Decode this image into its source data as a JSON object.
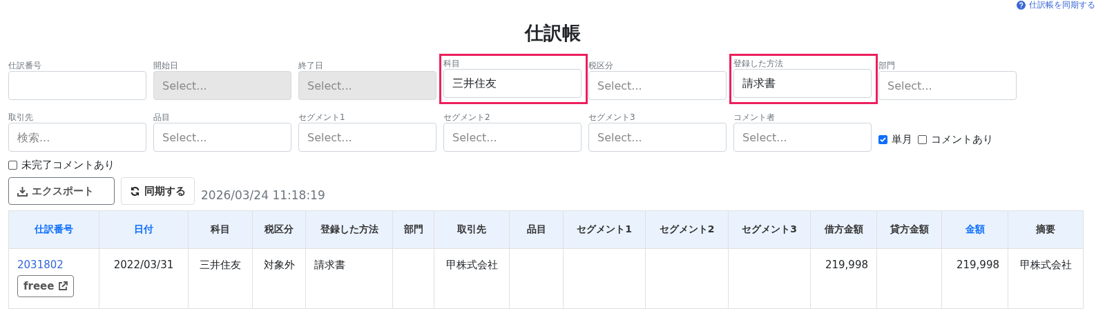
{
  "sync_link": {
    "label": "仕訳帳を同期する"
  },
  "title": "仕訳帳",
  "filters": [
    {
      "label": "仕訳番号",
      "disabled": false,
      "highlighted": false
    },
    {
      "label": "開始日",
      "placeholder": "Select...",
      "disabled": true,
      "highlighted": false
    },
    {
      "label": "終了日",
      "placeholder": "Select...",
      "disabled": true,
      "highlighted": false
    },
    {
      "label": "科目",
      "value": "三井住友",
      "disabled": false,
      "highlighted": true
    },
    {
      "label": "税区分",
      "placeholder": "Select...",
      "disabled": false,
      "highlighted": false
    },
    {
      "label": "登録した方法",
      "value": "請求書",
      "disabled": false,
      "highlighted": true
    },
    {
      "label": "部門",
      "placeholder": "Select...",
      "disabled": false,
      "highlighted": false
    },
    {
      "label": "取引先",
      "placeholder": "検索...",
      "disabled": false,
      "highlighted": false
    },
    {
      "label": "品目",
      "placeholder": "Select...",
      "disabled": false,
      "highlighted": false
    },
    {
      "label": "セグメント1",
      "placeholder": "Select...",
      "disabled": false,
      "highlighted": false
    },
    {
      "label": "セグメント2",
      "placeholder": "Select...",
      "disabled": false,
      "highlighted": false
    },
    {
      "label": "セグメント3",
      "placeholder": "Select...",
      "disabled": false,
      "highlighted": false
    },
    {
      "label": "コメント者",
      "placeholder": "Select...",
      "disabled": false,
      "highlighted": false
    }
  ],
  "inline_checks": [
    {
      "label": "単月",
      "checked": true
    },
    {
      "label": "コメントあり",
      "checked": false
    }
  ],
  "unresolved_check": {
    "label": "未完了コメントあり",
    "checked": false
  },
  "export_button": "エクスポート",
  "sync_button": "同期する",
  "last_synced": "2026/03/24 11:18:19",
  "table": {
    "columns": [
      {
        "label": "仕訳番号",
        "sortable": true
      },
      {
        "label": "日付",
        "sortable": true
      },
      {
        "label": "科目",
        "sortable": false
      },
      {
        "label": "税区分",
        "sortable": false
      },
      {
        "label": "登録した方法",
        "sortable": false
      },
      {
        "label": "部門",
        "sortable": false
      },
      {
        "label": "取引先",
        "sortable": false
      },
      {
        "label": "品目",
        "sortable": false
      },
      {
        "label": "セグメント1",
        "sortable": false
      },
      {
        "label": "セグメント2",
        "sortable": false
      },
      {
        "label": "セグメント3",
        "sortable": false
      },
      {
        "label": "借方金額",
        "sortable": false
      },
      {
        "label": "貸方金額",
        "sortable": false
      },
      {
        "label": "金額",
        "sortable": true
      },
      {
        "label": "摘要",
        "sortable": false
      }
    ],
    "rows": [
      {
        "link_button": "freee",
        "cells": [
          "2031802",
          "2022/03/31",
          "三井住友",
          "対象外",
          "請求書",
          "",
          "甲株式会社",
          "",
          "",
          "",
          "",
          "219,998",
          "",
          "219,998",
          "甲株式会社"
        ]
      }
    ]
  }
}
